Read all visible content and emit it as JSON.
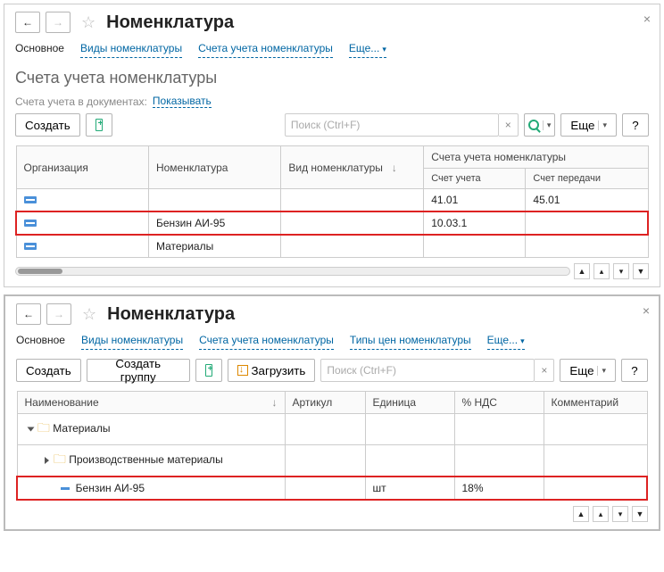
{
  "top": {
    "title": "Номенклатура",
    "tabs": {
      "main": "Основное",
      "types": "Виды номенклатуры",
      "accounts": "Счета учета номенклатуры",
      "more": "Еще..."
    },
    "subtitle": "Счета учета номенклатуры",
    "docs_label": "Счета учета в документах:",
    "docs_value": "Показывать",
    "create": "Создать",
    "search_placeholder": "Поиск (Ctrl+F)",
    "more_btn": "Еще",
    "help": "?",
    "cols": {
      "org": "Организация",
      "nomen": "Номенклатура",
      "type": "Вид номенклатуры",
      "acct_group": "Счета учета номенклатуры",
      "acct": "Счет учета",
      "transfer": "Счет передачи"
    },
    "rows": [
      {
        "org": "",
        "nomen": "",
        "type": "",
        "acct": "41.01",
        "transfer": "45.01",
        "hl": false
      },
      {
        "org": "",
        "nomen": "Бензин АИ-95",
        "type": "",
        "acct": "10.03.1",
        "transfer": "",
        "hl": true
      },
      {
        "org": "",
        "nomen": "Материалы",
        "type": "",
        "acct": "",
        "transfer": "",
        "hl": false
      }
    ]
  },
  "bottom": {
    "title": "Номенклатура",
    "tabs": {
      "main": "Основное",
      "types": "Виды номенклатуры",
      "accounts": "Счета учета номенклатуры",
      "pricetypes": "Типы цен номенклатуры",
      "more": "Еще..."
    },
    "create": "Создать",
    "create_group": "Создать группу",
    "load": "Загрузить",
    "search_placeholder": "Поиск (Ctrl+F)",
    "more_btn": "Еще",
    "help": "?",
    "cols": {
      "name": "Наименование",
      "article": "Артикул",
      "unit": "Единица",
      "vat": "% НДС",
      "comment": "Комментарий"
    },
    "rows": [
      {
        "indent": 1,
        "icon": "folder",
        "expand": "down",
        "name": "Материалы",
        "article": "",
        "unit": "",
        "vat": "",
        "comment": "",
        "hl": false
      },
      {
        "indent": 2,
        "icon": "folder",
        "expand": "right",
        "name": "Производственные материалы",
        "article": "",
        "unit": "",
        "vat": "",
        "comment": "",
        "hl": false
      },
      {
        "indent": 2,
        "icon": "item",
        "expand": "none",
        "name": "Бензин АИ-95",
        "article": "",
        "unit": "шт",
        "vat": "18%",
        "comment": "",
        "hl": true
      }
    ]
  }
}
